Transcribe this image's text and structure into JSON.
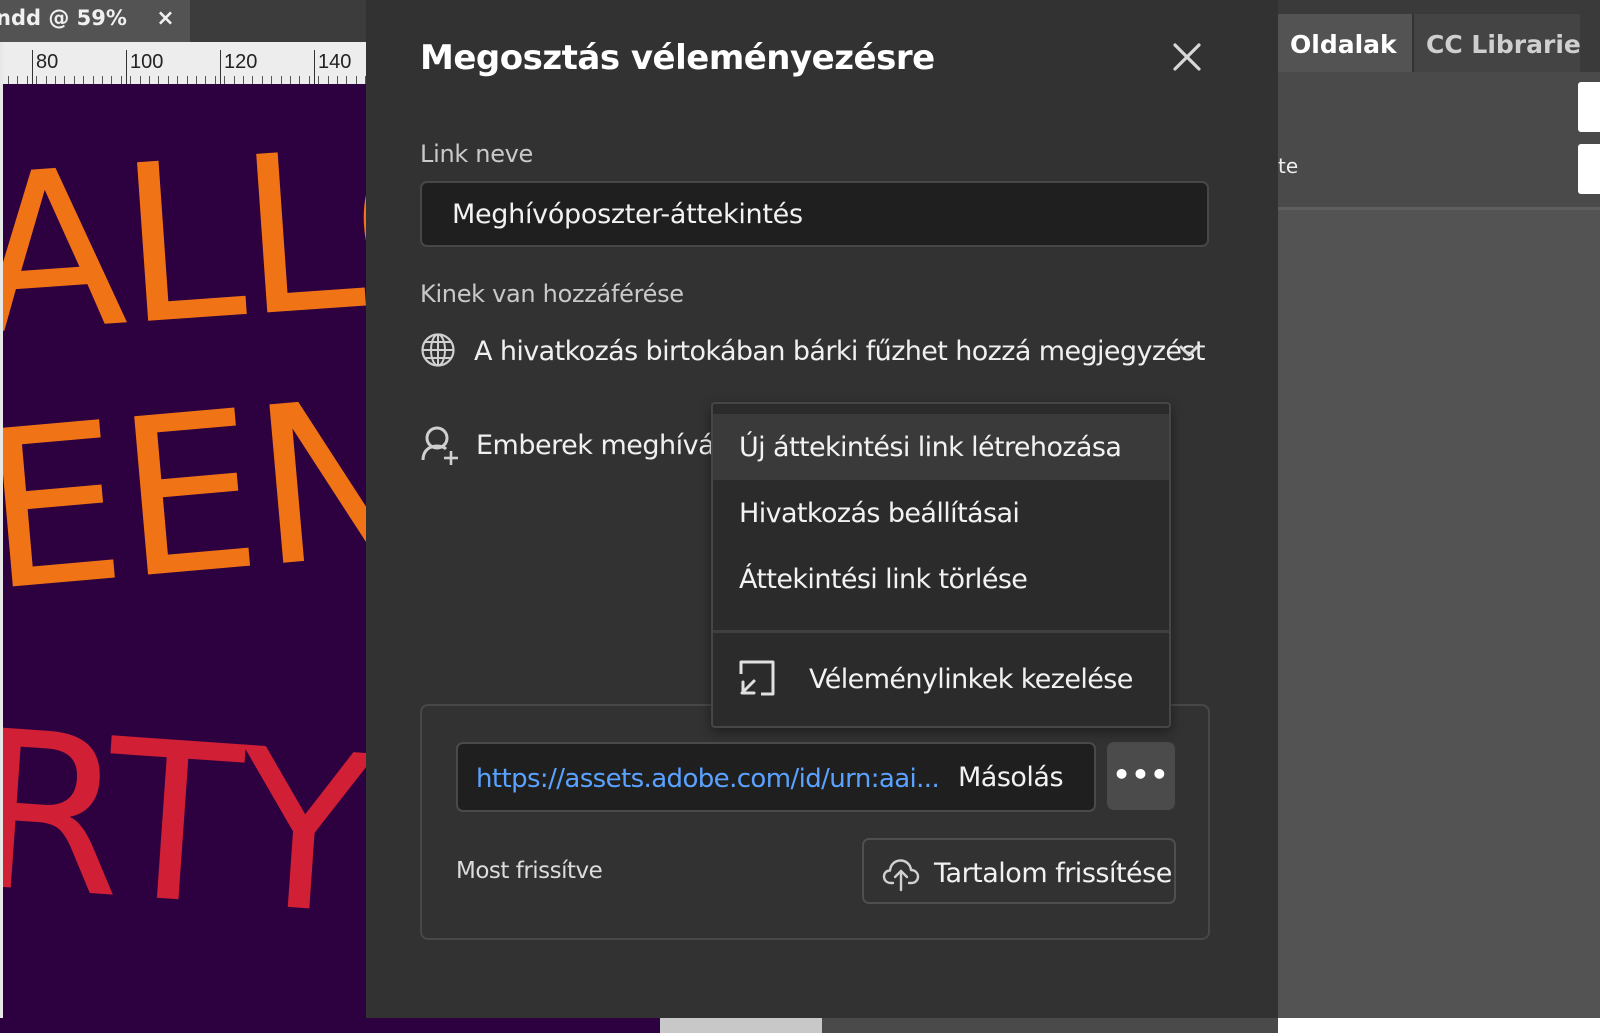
{
  "document": {
    "tab_title": "ndd @ 59%",
    "tab_close_glyph": "×",
    "ruler_labels": [
      "80",
      "100",
      "120",
      "140"
    ],
    "poster_words": [
      "ALLO",
      "EEN",
      "RTY"
    ],
    "poster_colors": {
      "background": "#2d0140",
      "orange": "#f07315",
      "red": "#d11f35"
    }
  },
  "right_panel": {
    "tabs": [
      "Oldalak",
      "CC Librarie"
    ],
    "partial_text": "te"
  },
  "dialog": {
    "title": "Megosztás véleményezésre",
    "close_icon": "close-icon",
    "link_name_label": "Link neve",
    "link_name_value": "Meghívóposzter-áttekintés",
    "access_label": "Kinek van hozzáférése",
    "access_icon": "globe-icon",
    "access_value": "A hivatkozás birtokában bárki fűzhet hozzá megjegyzést",
    "invite_icon": "add-person-icon",
    "invite_label": "Emberek meghívása",
    "link_url": "https://assets.adobe.com/id/urn:aai...",
    "copy_label": "Másolás",
    "more_label": "•••",
    "updated_text": "Most frissítve",
    "refresh_icon": "cloud-upload-icon",
    "refresh_label": "Tartalom frissítése"
  },
  "menu": {
    "items": [
      {
        "label": "Új áttekintési link létrehozása"
      },
      {
        "label": "Hivatkozás beállításai"
      },
      {
        "label": "Áttekintési link törlése"
      }
    ],
    "manage": {
      "icon": "manage-links-icon",
      "label": "Véleménylinkek kezelése"
    }
  },
  "colors": {
    "dialog_bg": "#323232",
    "input_bg": "#1f1f1f",
    "link_blue": "#5aa2ff",
    "panel_bg": "#535353"
  }
}
